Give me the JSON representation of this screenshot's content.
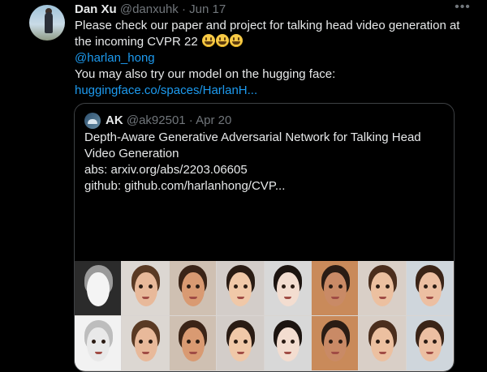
{
  "tweet": {
    "author_name": "Dan Xu",
    "handle": "@danxuhk",
    "separator": "·",
    "date": "Jun 17",
    "more_icon": "more-horizontal-icon",
    "text_line1": "Please check our paper and project for talking head video generation at the incoming CVPR 22",
    "emoji_icon": "grinning-face-emoji-icon",
    "mention": "@harlan_hong",
    "text_line2": "You may also try our model on the hugging face:",
    "link": "huggingface.co/spaces/HarlanH..."
  },
  "quote": {
    "author_name": "AK",
    "handle": "@ak92501",
    "separator": "·",
    "date": "Apr 20",
    "title": "Depth-Aware Generative Adversarial Network for Talking Head Video Generation",
    "abs_line": "abs: arxiv.org/abs/2203.06605",
    "github_line": "github: github.com/harlanhong/CVP..."
  },
  "colors": {
    "background": "#000000",
    "text": "#e7e9ea",
    "muted": "#71767b",
    "link": "#1d9bf0",
    "border": "#3e4144"
  }
}
